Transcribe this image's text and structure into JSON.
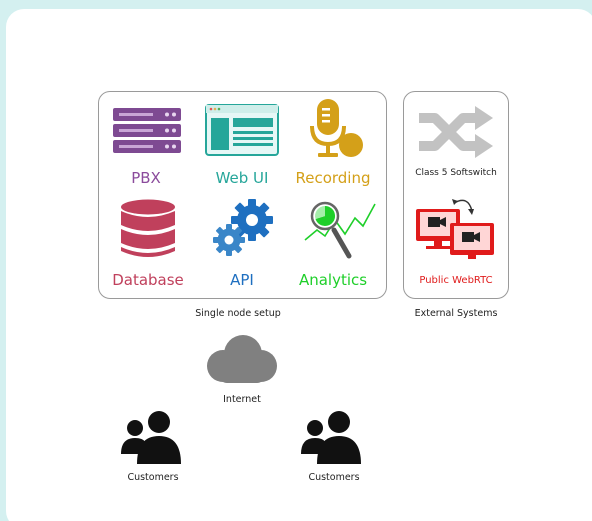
{
  "single_node": {
    "caption": "Single node setup",
    "components": {
      "pbx": {
        "label": "PBX",
        "color": "#8b4b9c",
        "icon": "server-rack-icon"
      },
      "webui": {
        "label": "Web UI",
        "color": "#26a69a",
        "icon": "browser-window-icon"
      },
      "recording": {
        "label": "Recording",
        "color": "#d4a019",
        "icon": "microphone-icon"
      },
      "database": {
        "label": "Database",
        "color": "#c0405c",
        "icon": "database-icon"
      },
      "api": {
        "label": "API",
        "color": "#1e6fc0",
        "icon": "gears-icon"
      },
      "analytics": {
        "label": "Analytics",
        "color": "#1fcf2a",
        "icon": "magnifier-chart-icon"
      }
    }
  },
  "external": {
    "caption": "External Systems",
    "softswitch": {
      "label": "Class 5 Softswitch",
      "icon": "shuffle-arrows-icon"
    },
    "webrtc": {
      "label": "Public WebRTC",
      "color": "#e01b1b",
      "icon": "video-screens-icon"
    }
  },
  "internet": {
    "label": "Internet",
    "icon": "cloud-icon"
  },
  "customers_left": {
    "label": "Customers",
    "icon": "users-icon"
  },
  "customers_right": {
    "label": "Customers",
    "icon": "users-icon"
  }
}
